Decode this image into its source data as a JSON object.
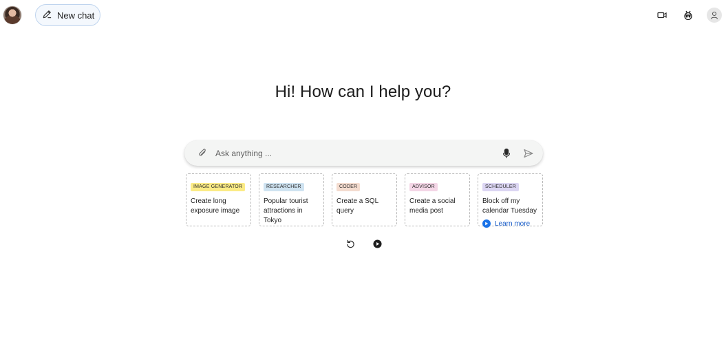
{
  "header": {
    "new_chat_label": "New chat"
  },
  "main": {
    "heading": "Hi! How can I help you?"
  },
  "input": {
    "placeholder": "Ask anything ..."
  },
  "cards": [
    {
      "badge": "IMAGE GENERATOR",
      "badge_color": "#fbeb86",
      "text": "Create long exposure image"
    },
    {
      "badge": "RESEARCHER",
      "badge_color": "#cfe3f1",
      "text": "Popular tourist attractions in Tokyo"
    },
    {
      "badge": "CODER",
      "badge_color": "#f4dccf",
      "text": "Create a SQL query"
    },
    {
      "badge": "ADVISOR",
      "badge_color": "#f4d6e6",
      "text": "Create a social media post"
    },
    {
      "badge": "SCHEDULER",
      "badge_color": "#dcd6f3",
      "text": "Block off my calendar Tuesday",
      "link": "Learn more"
    }
  ],
  "icons": {
    "top": [
      "video-icon",
      "bot-icon",
      "user-icon"
    ],
    "input": [
      "paperclip-icon",
      "microphone-icon",
      "send-icon"
    ],
    "controls": [
      "refresh-icon",
      "play-icon"
    ]
  },
  "colors": {
    "accent": "#1a73e8",
    "new_chat_border": "#bfd4ee",
    "input_bg": "#f4f5f4"
  }
}
